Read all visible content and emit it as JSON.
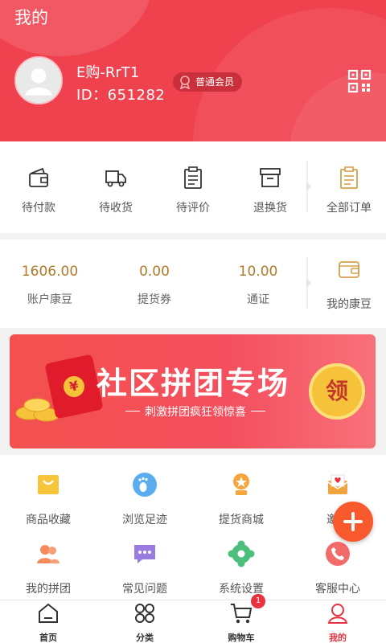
{
  "header": {
    "title": "我的",
    "username": "E购-RrT1",
    "user_id": "ID：651282",
    "member_level": "普通会员"
  },
  "orders": [
    {
      "label": "待付款",
      "icon": "wallet-icon"
    },
    {
      "label": "待收货",
      "icon": "truck-icon"
    },
    {
      "label": "待评价",
      "icon": "clipboard-icon"
    },
    {
      "label": "退换货",
      "icon": "box-icon"
    },
    {
      "label": "全部订单",
      "icon": "orders-icon"
    }
  ],
  "assets": [
    {
      "value": "1606.00",
      "label": "账户康豆"
    },
    {
      "value": "0.00",
      "label": "提货券"
    },
    {
      "value": "10.00",
      "label": "通证"
    }
  ],
  "wallet": {
    "label": "我的康豆",
    "icon": "wallet-icon"
  },
  "banner": {
    "title": "社区拼团专场",
    "subtitle": "刺激拼团疯狂领惊喜",
    "coin_text": "领",
    "envelope_text": "¥"
  },
  "services": [
    {
      "label": "商品收藏",
      "icon": "bag-icon"
    },
    {
      "label": "浏览足迹",
      "icon": "footprint-icon"
    },
    {
      "label": "提货商城",
      "icon": "medal-icon"
    },
    {
      "label": "邀请",
      "icon": "invite-mail-icon"
    },
    {
      "label": "我的拼团",
      "icon": "group-icon"
    },
    {
      "label": "常见问题",
      "icon": "chat-icon"
    },
    {
      "label": "系统设置",
      "icon": "settings-icon"
    },
    {
      "label": "客服中心",
      "icon": "phone-icon"
    }
  ],
  "bottom_nav": [
    {
      "label": "首页",
      "icon": "home-icon"
    },
    {
      "label": "分类",
      "icon": "category-icon"
    },
    {
      "label": "购物车",
      "icon": "cart-icon",
      "badge": "1"
    },
    {
      "label": "我的",
      "icon": "user-icon",
      "active": true
    }
  ],
  "colors": {
    "brand_red": "#f0414e",
    "asset_value": "#b07a2a",
    "fab": "#f85a2d"
  }
}
